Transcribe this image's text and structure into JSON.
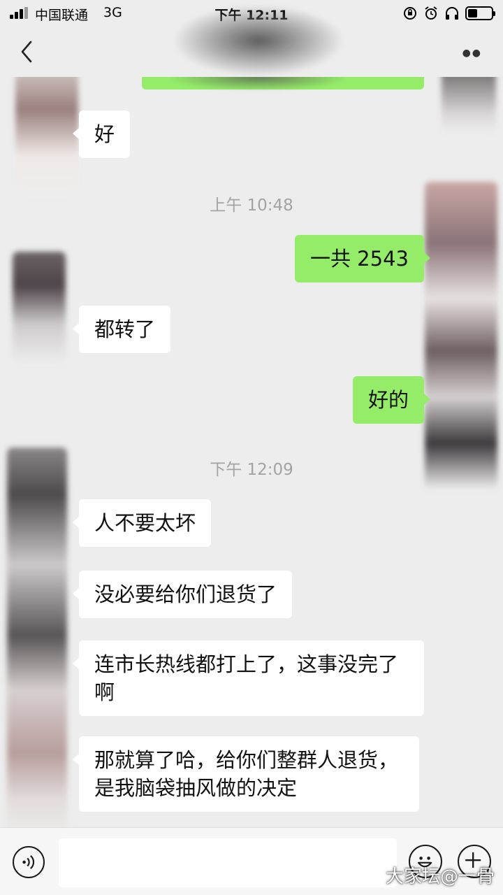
{
  "status_bar": {
    "carrier": "中国联通",
    "network": "3G",
    "time": "下午 12:11"
  },
  "nav": {
    "back_icon": "chevron-left-icon",
    "more_icon": "more-dots-icon"
  },
  "messages": [
    {
      "kind": "text",
      "side": "in",
      "text": "好"
    },
    {
      "kind": "time",
      "text": "上午 10:48"
    },
    {
      "kind": "text",
      "side": "out",
      "text": "一共 2543"
    },
    {
      "kind": "text",
      "side": "in",
      "text": "都转了"
    },
    {
      "kind": "text",
      "side": "out",
      "text": "好的"
    },
    {
      "kind": "time",
      "text": "下午 12:09"
    },
    {
      "kind": "text",
      "side": "in",
      "text": "人不要太坏"
    },
    {
      "kind": "text",
      "side": "in",
      "text": "没必要给你们退货了"
    },
    {
      "kind": "text",
      "side": "in",
      "text": "连市长热线都打上了，这事没完了\n啊"
    },
    {
      "kind": "text",
      "side": "in",
      "text": "那就算了哈，给你们整群人退货，\n是我脑袋抽风做的决定"
    }
  ],
  "input_bar": {
    "voice_icon": "voice-icon",
    "emoji_icon": "emoji-icon",
    "plus_icon": "plus-icon",
    "input_value": ""
  },
  "watermark": "大家坛@一骨",
  "colors": {
    "background": "#ededed",
    "outgoing_bubble": "#95ec69",
    "incoming_bubble": "#ffffff",
    "timestamp": "#a3a3a3"
  }
}
